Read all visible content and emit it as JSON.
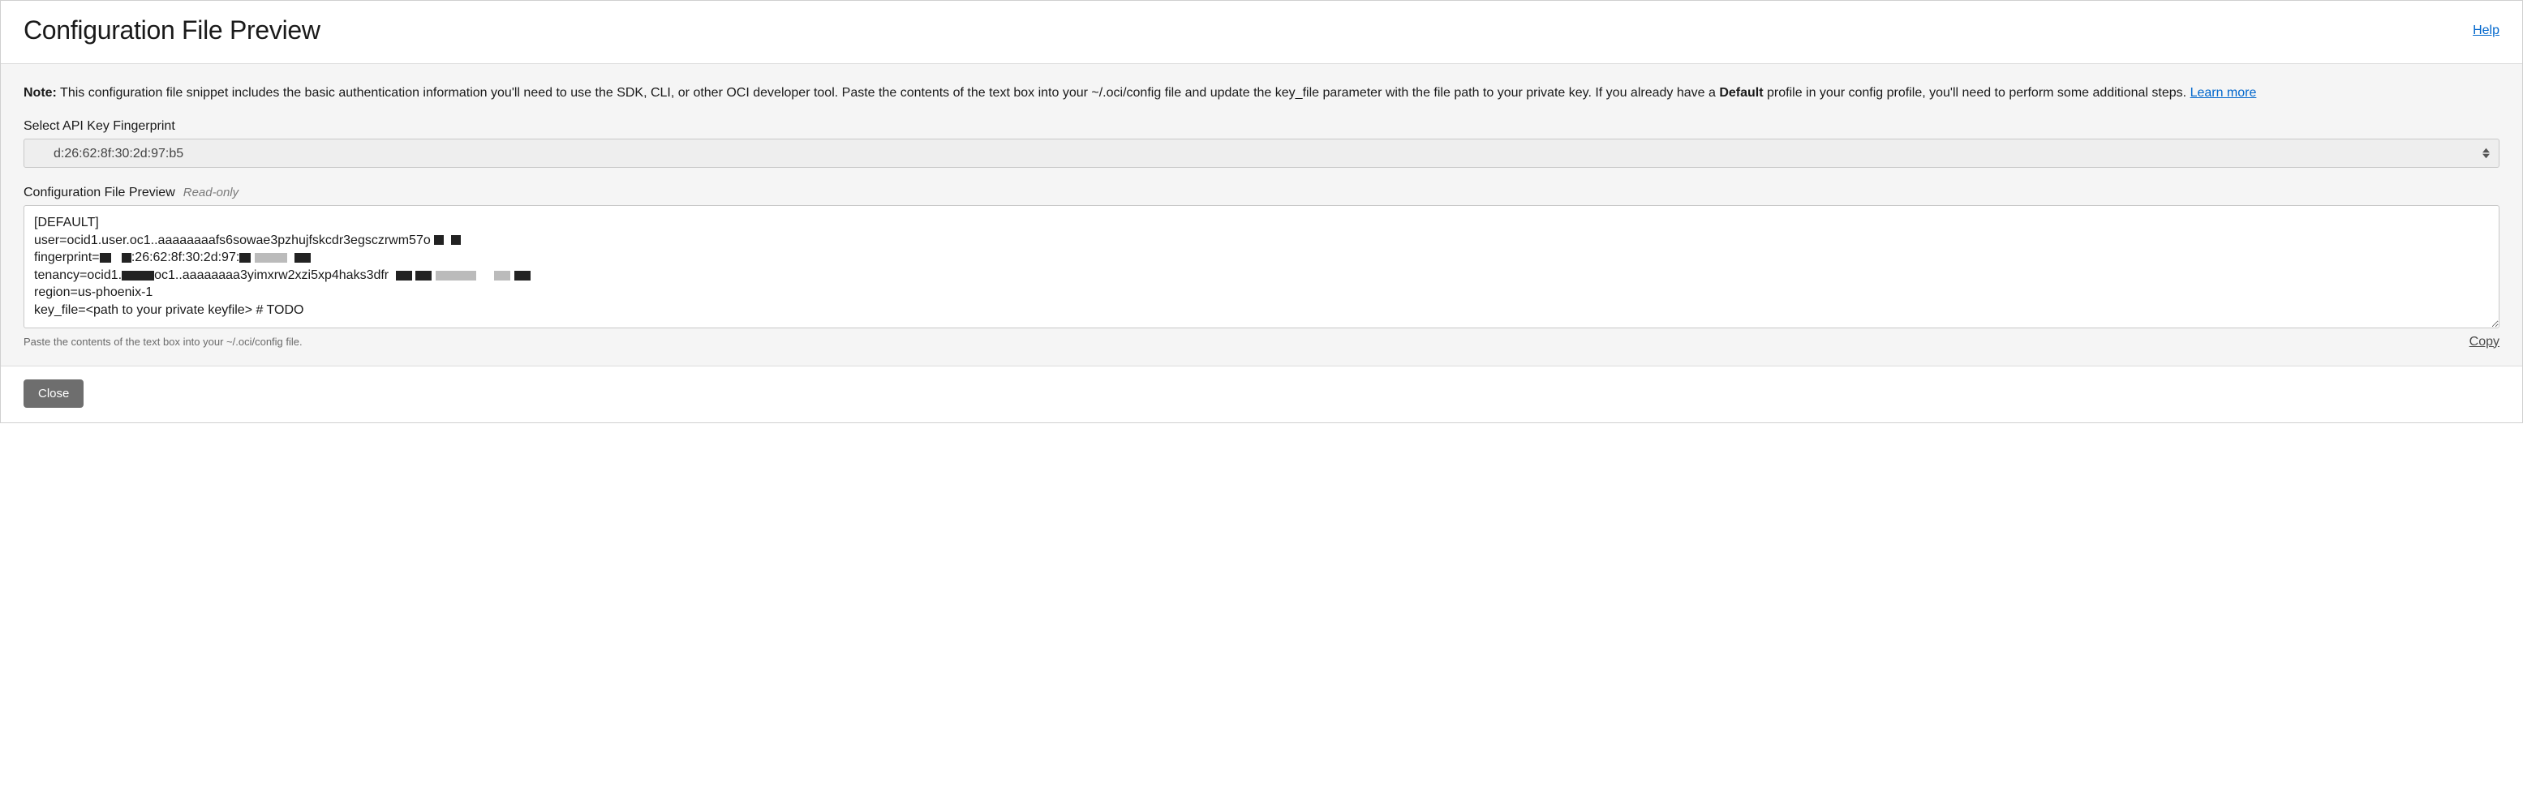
{
  "header": {
    "title": "Configuration File Preview",
    "help_label": "Help"
  },
  "note": {
    "prefix": "Note:",
    "body_part1": " This configuration file snippet includes the basic authentication information you'll need to use the SDK, CLI, or other OCI developer tool. Paste the contents of the text box into your ~/.oci/config file and update the key_file parameter with the file path to your private key. If you already have a ",
    "default_word": "Default",
    "body_part2": " profile in your config profile, you'll need to perform some additional steps. ",
    "learn_more": "Learn more"
  },
  "fingerprint": {
    "label": "Select API Key Fingerprint",
    "selected": "d:26:62:8f:30:2d:97:b5"
  },
  "preview": {
    "label": "Configuration File Preview",
    "readonly": "Read-only",
    "lines": {
      "l1": "[DEFAULT]",
      "l2": "user=ocid1.user.oc1..aaaaaaaafs6sowae3pzhujfskcdr3egsczrwm57o",
      "l3a": "fingerprint=",
      "l3b": ":26:62:8f:30:2d:97:",
      "l4a": "tenancy=ocid1.",
      "l4b": "oc1..aaaaaaaa3yimxrw2xzi5xp4haks3dfr",
      "l5": "region=us-phoenix-1",
      "l6": "key_file=<path to your private keyfile> # TODO"
    },
    "hint": "Paste the contents of the text box into your ~/.oci/config file.",
    "copy": "Copy"
  },
  "footer": {
    "close": "Close"
  }
}
